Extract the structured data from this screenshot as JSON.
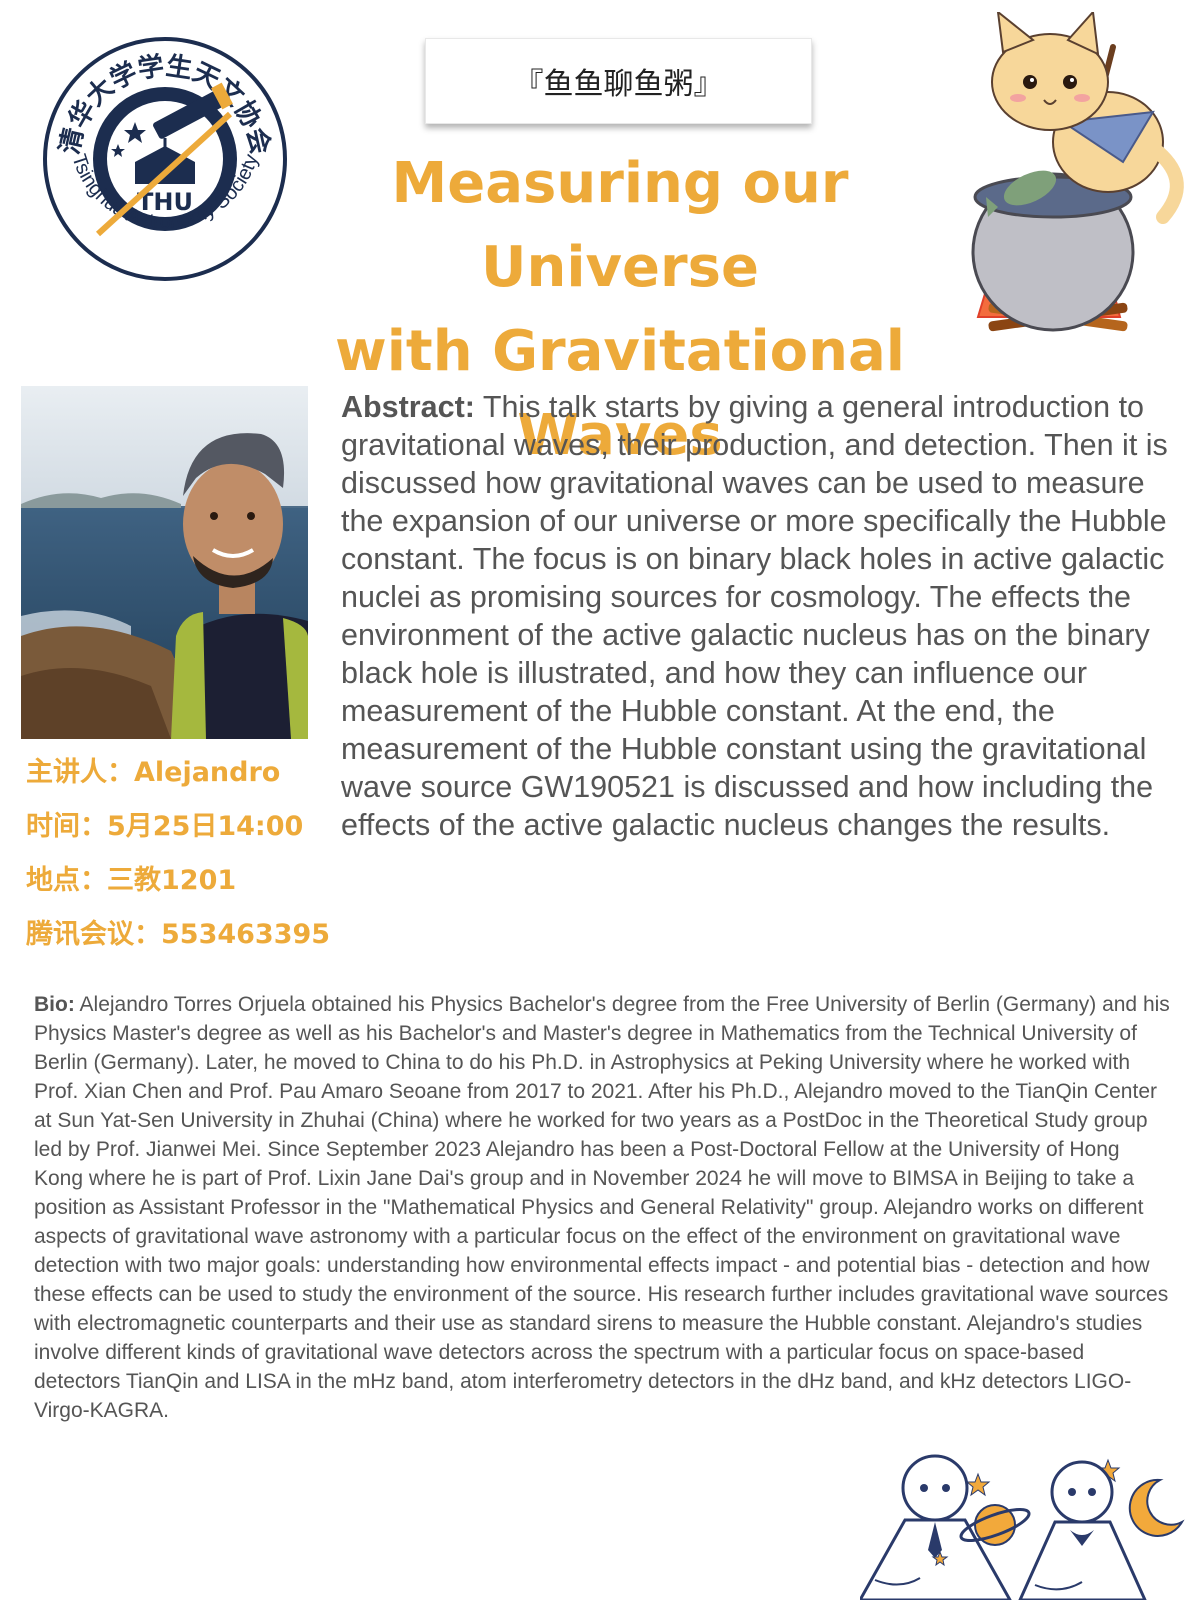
{
  "logo": {
    "chinese_name": "清华大学学生天文协会",
    "english_name": "Tsinghua Astronomy Society",
    "monogram": "THU"
  },
  "series": {
    "name": "『鱼鱼聊鱼粥』"
  },
  "title": {
    "line1": "Measuring our Universe",
    "line2": "with Gravitational Waves"
  },
  "info": {
    "speaker": "主讲人：Alejandro",
    "time": "时间：5月25日14:00",
    "location": "地点：三教1201",
    "meeting": "腾讯会议：553463395"
  },
  "abstract": {
    "label": "Abstract:",
    "text": "This talk starts by giving a general introduction to gravitational waves, their production, and detection. Then it is discussed how gravitational waves can be used to measure the expansion of our universe or more specifically the Hubble constant. The focus is on binary black holes in active galactic nuclei as promising sources for cosmology. The effects the environment of the active galactic nucleus has on the binary black hole is illustrated, and how they can influence our measurement of the Hubble constant. At the end, the measurement of the Hubble constant using the gravitational wave source GW190521 is discussed and how including the effects of the active galactic nucleus changes the results."
  },
  "bio": {
    "label": "Bio:",
    "text": "Alejandro Torres Orjuela obtained his Physics Bachelor's degree from the Free University of Berlin (Germany) and his Physics Master's degree as well as his Bachelor's and Master's degree in Mathematics from the Technical University of Berlin (Germany). Later, he moved to China to do his Ph.D. in Astrophysics at Peking University where he worked with Prof. Xian Chen and Prof. Pau Amaro Seoane from 2017 to 2021. After his Ph.D., Alejandro moved to the TianQin Center at Sun Yat-Sen University in Zhuhai (China) where he worked for two years as a PostDoc in the Theoretical Study group led by Prof. Jianwei Mei. Since September 2023 Alejandro has been a Post-Doctoral Fellow at the University of Hong Kong where he is part of Prof. Lixin Jane Dai's group and in November 2024 he will move to BIMSA in Beijing to take a position as Assistant Professor in the \"Mathematical Physics and General Relativity\" group. Alejandro works on different aspects of gravitational wave astronomy with a particular focus on the effect of the environment on gravitational wave detection with two major goals: understanding how environmental effects impact - and potential bias - detection and how these effects can be used to study the environment of the source. His research further includes gravitational wave sources with electromagnetic counterparts and their use as standard sirens to measure the Hubble constant. Alejandro's studies involve different kinds of gravitational wave detectors across the spectrum with a particular focus on space-based detectors TianQin and LISA in the mHz band, atom interferometry detectors in the dHz band, and kHz detectors LIGO-Virgo-KAGRA."
  },
  "colors": {
    "accent": "#EDAA3A",
    "navy": "#1c2d4f",
    "body_text": "#555555"
  },
  "icons": {
    "society_logo": "observatory-telescope-logo",
    "mascot": "cat-cooking-fish-porridge",
    "decoration": "teru-teru-bozu-dolls"
  }
}
